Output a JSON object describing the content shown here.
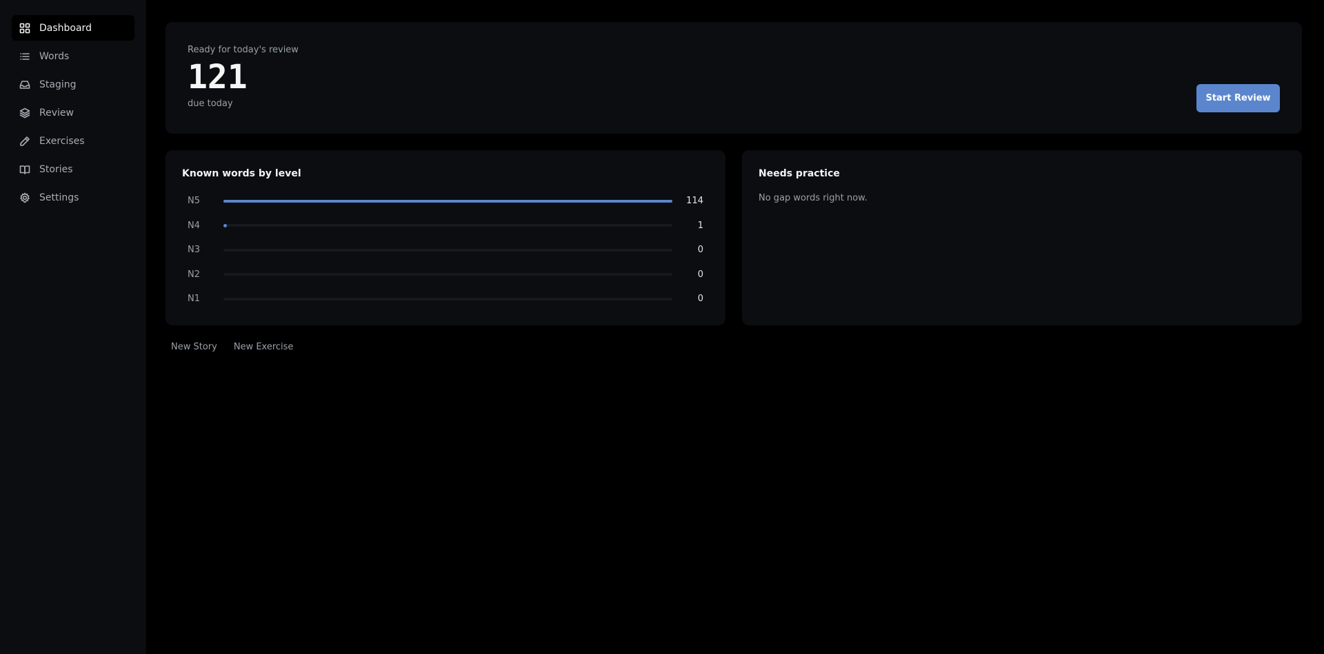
{
  "sidebar": {
    "items": [
      {
        "label": "Dashboard",
        "icon": "grid-icon",
        "active": true
      },
      {
        "label": "Words",
        "icon": "list-icon"
      },
      {
        "label": "Staging",
        "icon": "inbox-icon"
      },
      {
        "label": "Review",
        "icon": "layers-icon"
      },
      {
        "label": "Exercises",
        "icon": "pencil-icon"
      },
      {
        "label": "Stories",
        "icon": "book-icon"
      },
      {
        "label": "Settings",
        "icon": "gear-icon"
      }
    ]
  },
  "hero": {
    "label": "Ready for today's review",
    "count": "121",
    "sub": "due today",
    "button": "Start Review"
  },
  "known": {
    "title": "Known words by level",
    "max": 114,
    "levels": [
      {
        "name": "N5",
        "count": 114
      },
      {
        "name": "N4",
        "count": 1
      },
      {
        "name": "N3",
        "count": 0
      },
      {
        "name": "N2",
        "count": 0
      },
      {
        "name": "N1",
        "count": 0
      }
    ]
  },
  "practice": {
    "title": "Needs practice",
    "empty": "No gap words right now."
  },
  "actions": {
    "new_story": "New Story",
    "new_exercise": "New Exercise"
  },
  "colors": {
    "accent": "#5b86cd",
    "background": "#000000",
    "card": "#0b0d10"
  }
}
